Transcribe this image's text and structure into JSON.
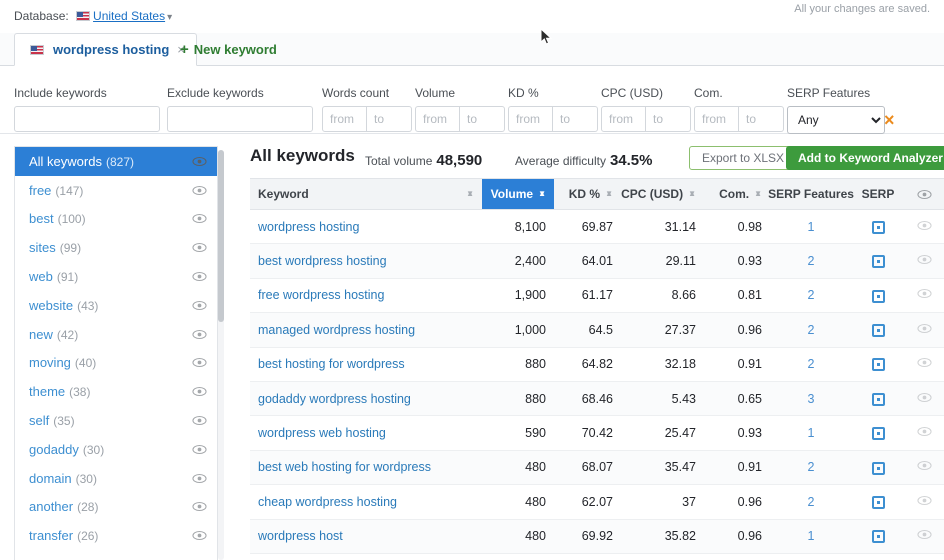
{
  "header": {
    "database_label": "Database:",
    "database_value": "United States",
    "saved_note": "All your changes are saved."
  },
  "tabs": {
    "active_tab": "wordpress hosting",
    "close_label": "×",
    "new_keyword": "New keyword",
    "plus": "+"
  },
  "filters": [
    {
      "label": "Include keywords",
      "type": "text",
      "value": "",
      "placeholder": ""
    },
    {
      "label": "Exclude keywords",
      "type": "text",
      "value": "",
      "placeholder": ""
    },
    {
      "label": "Words count",
      "type": "range",
      "from_placeholder": "from",
      "to_placeholder": "to"
    },
    {
      "label": "Volume",
      "type": "range",
      "from_placeholder": "from",
      "to_placeholder": "to"
    },
    {
      "label": "KD %",
      "type": "range",
      "from_placeholder": "from",
      "to_placeholder": "to"
    },
    {
      "label": "CPC (USD)",
      "type": "range",
      "from_placeholder": "from",
      "to_placeholder": "to"
    },
    {
      "label": "Com.",
      "type": "range",
      "from_placeholder": "from",
      "to_placeholder": "to"
    },
    {
      "label": "SERP Features",
      "type": "select",
      "value": "Any",
      "options": [
        "Any"
      ]
    }
  ],
  "filter_clear_label": "×",
  "sidebar": {
    "items": [
      {
        "name": "All keywords",
        "count": "(827)",
        "active": true
      },
      {
        "name": "free",
        "count": "(147)",
        "active": false
      },
      {
        "name": "best",
        "count": "(100)",
        "active": false
      },
      {
        "name": "sites",
        "count": "(99)",
        "active": false
      },
      {
        "name": "web",
        "count": "(91)",
        "active": false
      },
      {
        "name": "website",
        "count": "(43)",
        "active": false
      },
      {
        "name": "new",
        "count": "(42)",
        "active": false
      },
      {
        "name": "moving",
        "count": "(40)",
        "active": false
      },
      {
        "name": "theme",
        "count": "(38)",
        "active": false
      },
      {
        "name": "self",
        "count": "(35)",
        "active": false
      },
      {
        "name": "godaddy",
        "count": "(30)",
        "active": false
      },
      {
        "name": "domain",
        "count": "(30)",
        "active": false
      },
      {
        "name": "another",
        "count": "(28)",
        "active": false
      },
      {
        "name": "transfer",
        "count": "(26)",
        "active": false
      }
    ]
  },
  "main": {
    "title": "All keywords",
    "total_volume_label": "Total volume",
    "total_volume_value": "48,590",
    "avg_difficulty_label": "Average difficulty",
    "avg_difficulty_value": "34.5%",
    "export_button": "Export to XLSX",
    "analyzer_button": "Add to Keyword Analyzer"
  },
  "table": {
    "columns": [
      {
        "key": "keyword",
        "label": "Keyword",
        "sortable": true,
        "active": false
      },
      {
        "key": "volume",
        "label": "Volume",
        "sortable": true,
        "active": true
      },
      {
        "key": "kd",
        "label": "KD %",
        "sortable": true,
        "active": false
      },
      {
        "key": "cpc",
        "label": "CPC (USD)",
        "sortable": true,
        "active": false
      },
      {
        "key": "com",
        "label": "Com.",
        "sortable": true,
        "active": false
      },
      {
        "key": "serpf",
        "label": "SERP Features",
        "sortable": false,
        "active": false
      },
      {
        "key": "serp",
        "label": "SERP",
        "sortable": false,
        "active": false
      },
      {
        "key": "eye",
        "label": "",
        "sortable": false,
        "active": false
      }
    ],
    "rows": [
      {
        "keyword": "wordpress hosting",
        "volume": "8,100",
        "kd": "69.87",
        "cpc": "31.14",
        "com": "0.98",
        "serpf": "1"
      },
      {
        "keyword": "best wordpress hosting",
        "volume": "2,400",
        "kd": "64.01",
        "cpc": "29.11",
        "com": "0.93",
        "serpf": "2"
      },
      {
        "keyword": "free wordpress hosting",
        "volume": "1,900",
        "kd": "61.17",
        "cpc": "8.66",
        "com": "0.81",
        "serpf": "2"
      },
      {
        "keyword": "managed wordpress hosting",
        "volume": "1,000",
        "kd": "64.5",
        "cpc": "27.37",
        "com": "0.96",
        "serpf": "2"
      },
      {
        "keyword": "best hosting for wordpress",
        "volume": "880",
        "kd": "64.82",
        "cpc": "32.18",
        "com": "0.91",
        "serpf": "2"
      },
      {
        "keyword": "godaddy wordpress hosting",
        "volume": "880",
        "kd": "68.46",
        "cpc": "5.43",
        "com": "0.65",
        "serpf": "3"
      },
      {
        "keyword": "wordpress web hosting",
        "volume": "590",
        "kd": "70.42",
        "cpc": "25.47",
        "com": "0.93",
        "serpf": "1"
      },
      {
        "keyword": "best web hosting for wordpress",
        "volume": "480",
        "kd": "68.07",
        "cpc": "35.47",
        "com": "0.91",
        "serpf": "2"
      },
      {
        "keyword": "cheap wordpress hosting",
        "volume": "480",
        "kd": "62.07",
        "cpc": "37",
        "com": "0.96",
        "serpf": "2"
      },
      {
        "keyword": "wordpress host",
        "volume": "480",
        "kd": "69.92",
        "cpc": "35.82",
        "com": "0.96",
        "serpf": "1"
      }
    ]
  },
  "colors": {
    "accent_blue": "#2c7fd6",
    "accent_green": "#3d9b3d",
    "link_blue": "#2a7ab9",
    "warning_orange": "#eb8b1e"
  }
}
